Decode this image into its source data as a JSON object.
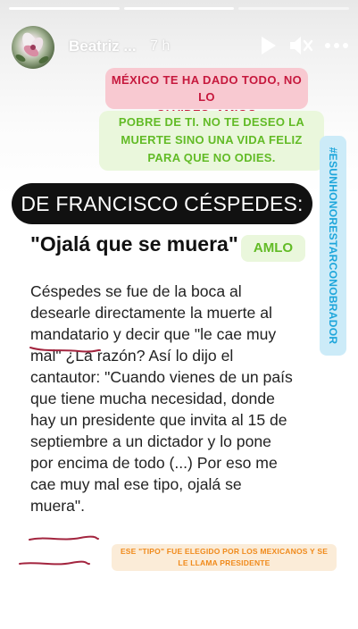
{
  "header": {
    "username": "Beatriz ...",
    "time_ago": "7 h",
    "progress": [
      1,
      1,
      0
    ],
    "controls": {
      "play_icon": "play-icon",
      "mute_icon": "speaker-muted-icon",
      "more_icon": "more-dots-icon"
    }
  },
  "stickers": {
    "mexico": {
      "line1": "MÉXICO TE HA DADO TODO, NO LO",
      "line2": "OLVIDES, AMIGO",
      "bg": "#f8c9d1",
      "color": "#c6183d"
    },
    "pobre": {
      "line1": "POBRE DE TI. NO TE DESEO LA",
      "line2": "MUERTE SINO UNA VIDA FELIZ",
      "line3": "PARA QUE NO ODIES.",
      "bg": "#eaf7dc",
      "color": "#62bb26"
    },
    "hashtag": {
      "text": "#ESUNHONORESTARCONOBRADOR",
      "bg": "#ccebf8",
      "color": "#1da6db"
    },
    "amlo": "AMLO",
    "note": {
      "line1": "ESE \"TIPO\" FUE ELEGIDO POR LOS MEXICANOS Y SE",
      "line2": "LE LLAMA PRESIDENTE",
      "bg": "#fbecd8",
      "color": "#f08a1b"
    }
  },
  "article": {
    "headline": "DE FRANCISCO CÉSPEDES:",
    "quote": "\"Ojalá que se muera\"",
    "lines": [
      "Céspedes se fue de la boca al",
      "desearle directamente la muerte al",
      "mandatario y decir que \"le cae muy",
      "mal\" ¿La razón? Así lo dijo el",
      "cantautor: \"Cuando vienes de un país",
      "que tiene mucha necesidad, donde",
      "hay un presidente que invita al 15 de",
      "septiembre a un dictador y lo pone",
      "por encima de todo (...) Por eso me",
      "cae muy mal ese tipo, ojalá se",
      "muera\"."
    ],
    "underline_color": "#a3253f"
  }
}
